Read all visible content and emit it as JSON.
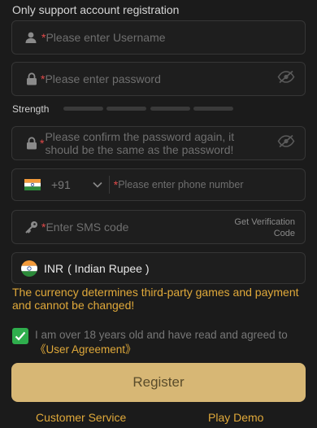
{
  "heading": "Only support account registration",
  "username": {
    "required_mark": "*",
    "placeholder": "Please enter Username",
    "icon": "user-icon"
  },
  "password": {
    "required_mark": "*",
    "placeholder": "Please enter password",
    "icon": "lock-icon",
    "toggle_icon": "eye-off-icon"
  },
  "strength": {
    "label": "Strength",
    "segments": 4,
    "filled": 0
  },
  "confirm_password": {
    "required_mark": "*",
    "placeholder_line1": "Please confirm the password again, it",
    "placeholder_line2": "should be the same as the password!",
    "icon": "lock-icon",
    "toggle_icon": "eye-off-icon"
  },
  "phone": {
    "country_code": "+91",
    "flag": "india-flag",
    "required_mark": "*",
    "placeholder": "Please enter phone number"
  },
  "sms": {
    "required_mark": "*",
    "placeholder": "Enter SMS code",
    "get_code_line1": "Get Verification",
    "get_code_line2": "Code",
    "icon": "key-icon"
  },
  "currency": {
    "code": "INR",
    "name": "( Indian Rupee )",
    "flag": "india-flag-round"
  },
  "notice": "The currency determines third-party games and payment and cannot be changed!",
  "agreement": {
    "checked": true,
    "text": "I am over 18 years old and have read and agreed to",
    "link": "《User Agreement》"
  },
  "register_label": "Register",
  "footer": {
    "customer_service": "Customer Service",
    "play_demo": "Play Demo"
  },
  "colors": {
    "accent": "#e0a93a",
    "button": "#d7b775",
    "required": "#e34a4a",
    "check": "#2fae4d"
  }
}
